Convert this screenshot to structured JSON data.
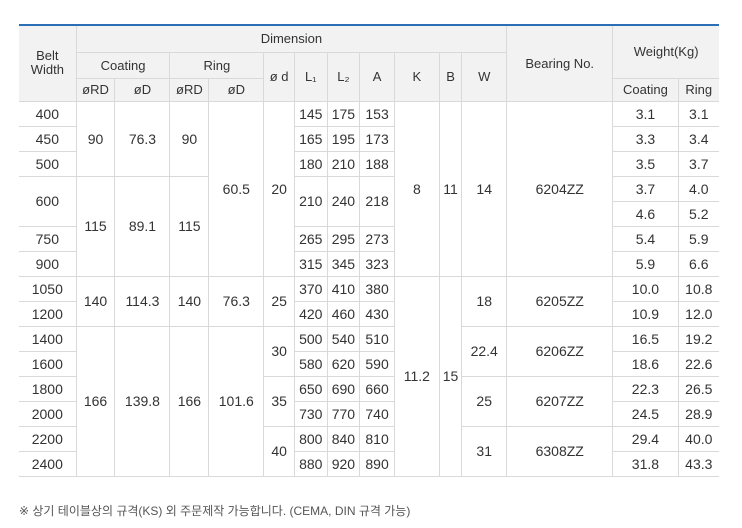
{
  "headers": {
    "belt_width": "Belt\nWidth",
    "dimension": "Dimension",
    "coating": "Coating",
    "ring": "Ring",
    "phi_d": "ø d",
    "l1": "L₁",
    "l2": "L₂",
    "a": "A",
    "k": "K",
    "b": "B",
    "w": "W",
    "bearing_no": "Bearing No.",
    "weight": "Weight(Kg)",
    "coating_rd": "øRD",
    "coating_d": "øD",
    "ring_rd": "øRD",
    "ring_d": "øD",
    "weight_coating": "Coating",
    "weight_ring": "Ring"
  },
  "belt_widths": [
    "400",
    "450",
    "500",
    "600",
    "750",
    "900",
    "1050",
    "1200",
    "1400",
    "1600",
    "1800",
    "2000",
    "2200",
    "2400"
  ],
  "groups": {
    "coat_rd": [
      "90",
      "115",
      "140",
      "166"
    ],
    "coat_d": [
      "76.3",
      "89.1",
      "114.3",
      "139.8"
    ],
    "ring_rd": [
      "90",
      "115",
      "140",
      "166"
    ],
    "ring_d": [
      "60.5",
      "76.3",
      "101.6"
    ],
    "phi_d": [
      "20",
      "25",
      "30",
      "35",
      "40"
    ],
    "k": [
      "8",
      "11.2"
    ],
    "b": [
      "11",
      "15"
    ],
    "w": [
      "14",
      "18",
      "22.4",
      "25",
      "31"
    ],
    "bearing": [
      "6204ZZ",
      "6205ZZ",
      "6206ZZ",
      "6207ZZ",
      "6308ZZ"
    ]
  },
  "l1": [
    "145",
    "165",
    "180",
    "210",
    "265",
    "315",
    "370",
    "420",
    "500",
    "580",
    "650",
    "730",
    "800",
    "880"
  ],
  "l2": [
    "175",
    "195",
    "210",
    "240",
    "295",
    "345",
    "410",
    "460",
    "540",
    "620",
    "690",
    "770",
    "840",
    "920"
  ],
  "a": [
    "153",
    "173",
    "188",
    "218",
    "273",
    "323",
    "380",
    "430",
    "510",
    "590",
    "660",
    "740",
    "810",
    "890"
  ],
  "weight_coating": [
    "3.1",
    "3.3",
    "3.5",
    "3.7",
    "4.6",
    "5.4",
    "5.9",
    "10.0",
    "10.9",
    "16.5",
    "18.6",
    "22.3",
    "24.5",
    "29.4",
    "31.8"
  ],
  "weight_ring": [
    "3.1",
    "3.4",
    "3.7",
    "4.0",
    "5.2",
    "5.9",
    "6.6",
    "10.8",
    "12.0",
    "19.2",
    "22.6",
    "26.5",
    "28.9",
    "40.0",
    "43.3"
  ],
  "footnote": "※ 상기 테이블상의 규격(KS) 외 주문제작 가능합니다. (CEMA, DIN 규격 가능)"
}
